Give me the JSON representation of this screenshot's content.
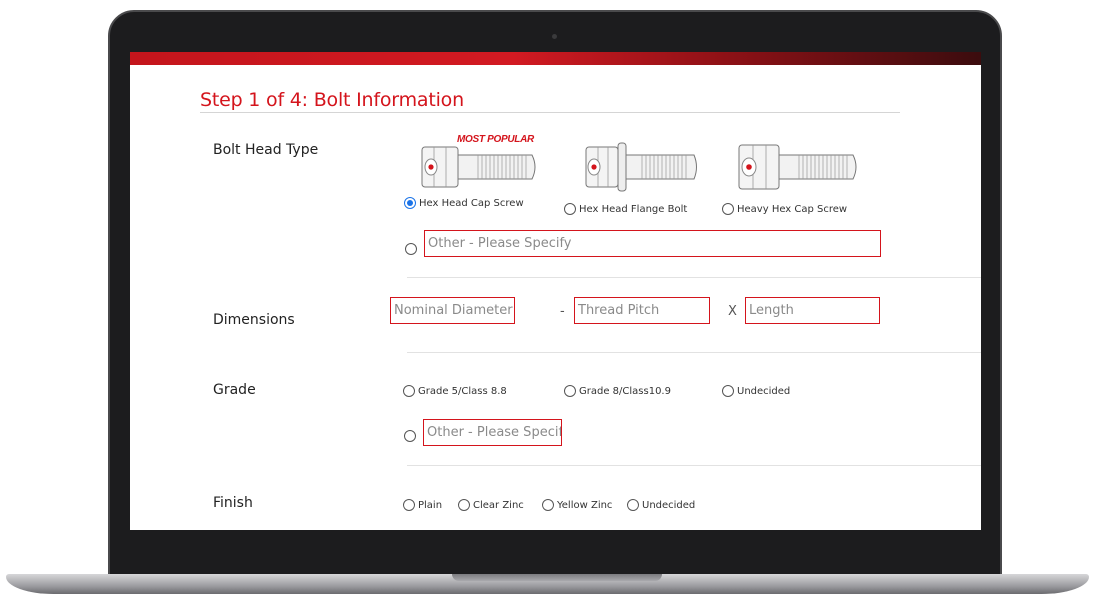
{
  "form": {
    "step_title": "Step 1 of 4: Bolt Information",
    "bolt_head": {
      "label": "Bolt Head Type",
      "badge": "MOST POPULAR",
      "options": [
        "Hex Head Cap Screw",
        "Hex Head Flange Bolt",
        "Heavy Hex Cap Screw"
      ],
      "selected": "Hex Head Cap Screw",
      "other_placeholder": "Other - Please Specify"
    },
    "dimensions": {
      "label": "Dimensions",
      "diameter_placeholder": "Nominal Diameter",
      "dash": "-",
      "thread_placeholder": "Thread Pitch",
      "times": "X",
      "length_placeholder": "Length"
    },
    "grade": {
      "label": "Grade",
      "options": [
        "Grade 5/Class 8.8",
        "Grade 8/Class10.9",
        "Undecided"
      ],
      "other_placeholder": "Other - Please Specify"
    },
    "finish": {
      "label": "Finish",
      "options": [
        "Plain",
        "Clear Zinc",
        "Yellow Zinc",
        "Undecided"
      ]
    }
  },
  "colors": {
    "accent": "#d4141c",
    "radio_selected": "#1a73e8"
  },
  "icons": [
    "hex-head-cap-screw-icon",
    "hex-head-flange-bolt-icon",
    "heavy-hex-cap-screw-icon"
  ]
}
